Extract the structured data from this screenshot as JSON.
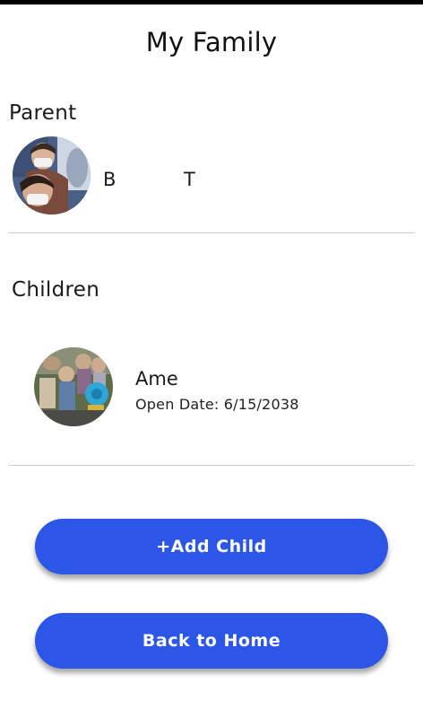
{
  "header": {
    "title": "My Family"
  },
  "parent_section": {
    "title": "Parent",
    "parent": {
      "first_name": "B",
      "last_name": "T",
      "avatar": "parent-photo"
    }
  },
  "children_section": {
    "title": "Children",
    "children": [
      {
        "name": "Ame",
        "open_date": "Open Date: 6/15/2038",
        "avatar": "child-photo"
      }
    ]
  },
  "actions": {
    "add_child_label": "+Add Child",
    "back_home_label": "Back to Home"
  },
  "colors": {
    "button": "#2c56e6",
    "button_text": "#ffffff",
    "divider": "#c9c9c9"
  }
}
